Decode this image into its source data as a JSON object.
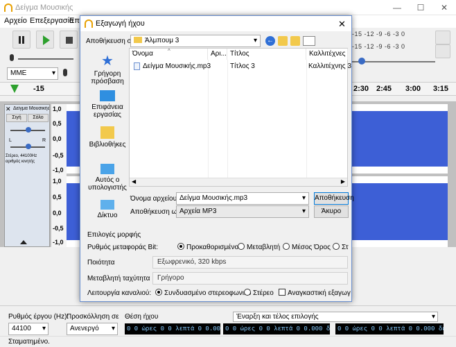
{
  "app": {
    "title": "Δείγμα Μουσικής",
    "menu": [
      "Αρχείο",
      "Επεξεργασία",
      "Επι"
    ],
    "host_label": "MME",
    "ruler": [
      "-15",
      "2:30",
      "2:45",
      "3:00",
      "3:15"
    ],
    "meter_ticks": "-15 -12 -9 -6 -3 0",
    "track": {
      "name": "Δείγμα Μουσικής",
      "mute": "Σιγή",
      "solo": "Σόλο",
      "left": "L",
      "right": "R",
      "info": "Στέρεο, 44100Hz αριθμός κινητής υποδιαστολής 32 bit",
      "scale_top": [
        "1,0",
        "0,5",
        "0,0",
        "-0,5",
        "-1,0"
      ],
      "scale_bottom": [
        "1,0",
        "0,5",
        "0,0",
        "-0,5",
        "-1,0"
      ]
    },
    "project_rate_label": "Ρυθμός έργου (Hz):",
    "project_rate_value": "44100",
    "snap_label": "Προσκόλληση σε",
    "snap_value": "Ανενεργό",
    "audio_position_label": "Θέση ήχου",
    "selection_label": "Έναρξη και τέλος επιλογής",
    "timecode": "0 0 ώρες 0 0 λεπτά 0 0.000 δευτ.",
    "status": "Σταματημένο."
  },
  "dialog": {
    "title": "Εξαγωγή ήχου",
    "save_in_label": "Αποθήκευση σε:",
    "save_in_value": "Άλμπουμ 3",
    "places": [
      {
        "icon": "star-icon",
        "label": "Γρήγορη πρόσβαση"
      },
      {
        "icon": "desktop-icon",
        "label": "Επιφάνεια εργασίας"
      },
      {
        "icon": "libraries-icon",
        "label": "Βιβλιοθήκες"
      },
      {
        "icon": "computer-icon",
        "label": "Αυτός ο υπολογιστής"
      },
      {
        "icon": "network-icon",
        "label": "Δίκτυο"
      }
    ],
    "columns": [
      "Όνομα",
      "Αρι...",
      "Τίτλος",
      "Καλλιτέχνες που"
    ],
    "files": [
      {
        "name": "Δείγμα Μουσικής.mp3",
        "num": "",
        "title": "Τίτλος 3",
        "artist": "Καλλιτέχνης 3"
      }
    ],
    "filename_label": "Όνομα αρχείου:",
    "filename_value": "Δείγμα Μουσικής.mp3",
    "savetype_label": "Αποθήκευση ως:",
    "savetype_value": "Αρχεία MP3",
    "save_button": "Αποθήκευση",
    "cancel_button": "Άκυρο",
    "format_options_title": "Επιλογές μορφής",
    "bitrate_mode_label": "Ρυθμός μεταφοράς Bit:",
    "bitrate_modes": [
      "Προκαθορισμένο",
      "Μεταβλητή",
      "Μέσος Όρος",
      "Στ"
    ],
    "quality_label": "Ποιότητα",
    "quality_value": "Εξωφρενικό, 320 kbps",
    "speed_label": "Μεταβλητή ταχύτητα",
    "speed_value": "Γρήγορο",
    "channel_mode_label": "Λειτουργία καναλιού:",
    "channel_modes": [
      "Συνδυασμένο στερεοφωνικό",
      "Στέρεο"
    ],
    "force_mono_label": "Αναγκαστική εξαγωγή σ"
  }
}
